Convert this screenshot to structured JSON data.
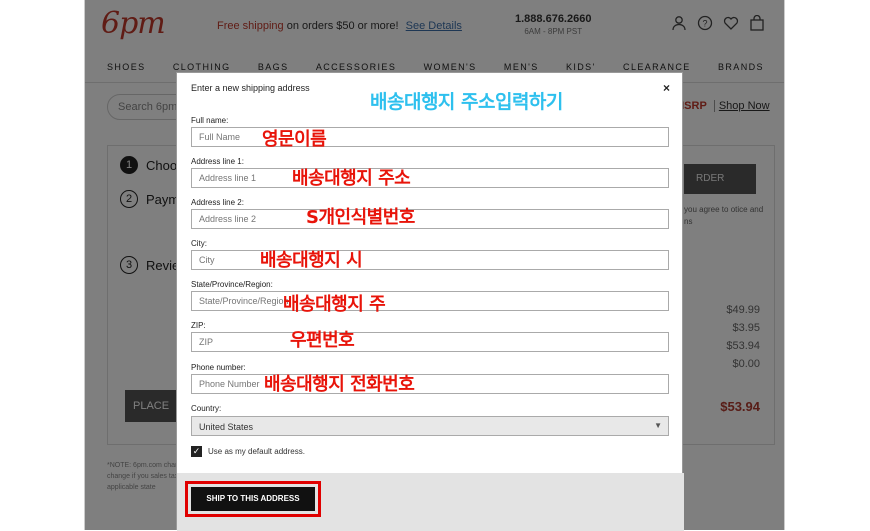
{
  "header": {
    "logo": "6pm",
    "promo_red": "Free shipping",
    "promo_rest": "on orders $50 or more!",
    "promo_link": "See Details",
    "phone": "1.888.676.2660",
    "hours": "6AM - 8PM PST",
    "icons": [
      "user-icon",
      "help-icon",
      "heart-icon",
      "cart-icon"
    ]
  },
  "nav": [
    "SHOES",
    "CLOTHING",
    "BAGS",
    "ACCESSORIES",
    "WOMEN'S",
    "MEN'S",
    "KIDS'",
    "CLEARANCE",
    "BRANDS"
  ],
  "search": {
    "placeholder": "Search 6pm.c"
  },
  "msrp": {
    "label": "MSRP",
    "shop": "Shop Now"
  },
  "checkout": {
    "steps": [
      {
        "num": "1",
        "label": "Choo"
      },
      {
        "num": "2",
        "label": "Payme"
      },
      {
        "num": "3",
        "label": "Review"
      }
    ],
    "place_label": "PLACE",
    "order_btn": "RDER",
    "terms": "you agree to otice and ns",
    "amounts": [
      "$49.99",
      "$3.95",
      "$53.94",
      "$0.00"
    ],
    "total": "$53.94",
    "note": "*NOTE: 6pm.com charges will be ad may change if you sales tax ultimate applicable state"
  },
  "modal": {
    "title": "Enter a new shipping address",
    "close": "×",
    "fields": [
      {
        "label": "Full name:",
        "placeholder": "Full Name"
      },
      {
        "label": "Address line 1:",
        "placeholder": "Address line 1"
      },
      {
        "label": "Address line 2:",
        "placeholder": "Address line 2"
      },
      {
        "label": "City:",
        "placeholder": "City"
      },
      {
        "label": "State/Province/Region:",
        "placeholder": "State/Province/Region"
      },
      {
        "label": "ZIP:",
        "placeholder": "ZIP"
      },
      {
        "label": "Phone number:",
        "placeholder": "Phone Number"
      }
    ],
    "country_label": "Country:",
    "country_value": "United States",
    "default_checkbox": "Use as my default address.",
    "submit": "SHIP TO THIS ADDRESS"
  },
  "annotations": {
    "title": "배송대행지 주소입력하기",
    "full_name": "영문이름",
    "address1": "배송대행지 주소",
    "address2": "S개인식별번호",
    "city": "배송대행지 시",
    "state": "배송대행지 주",
    "zip": "우편번호",
    "phone": "배송대행지 전화번호"
  },
  "colors": {
    "annotation_red": "#e8140a",
    "annotation_blue": "#2ec0ee",
    "highlight_box": "#e00000"
  }
}
